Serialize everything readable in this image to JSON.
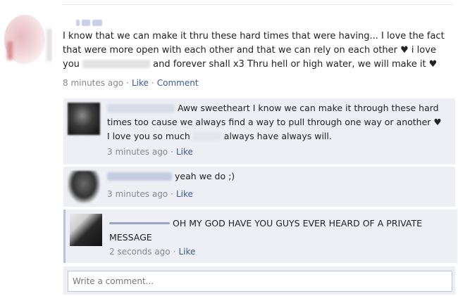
{
  "post": {
    "text_1": "I know that we can make it thru these hard times that were having... I love the fact that were more open with each other and that we can rely on each other ♥ i love you",
    "text_2": "and forever shall x3 Thru hell or high water, we will make it ♥",
    "time": "8 minutes ago",
    "like_label": "Like",
    "comment_label": "Comment"
  },
  "comments": [
    {
      "text_1": "Aww sweetheart I know we can make it through these hard times too cause we always find a way to pull through one way or another ♥ I love you so much",
      "text_2": "always have always will.",
      "time": "3 minutes ago",
      "like_label": "Like"
    },
    {
      "text_1": "yeah we do ;)",
      "time": "3 minutes ago",
      "like_label": "Like"
    },
    {
      "text_1": "OH MY GOD HAVE YOU GUYS EVER HEARD OF A PRIVATE MESSAGE",
      "time": "2 seconds ago",
      "like_label": "Like"
    }
  ],
  "composer": {
    "placeholder": "Write a comment..."
  },
  "separator": "·",
  "colors": {
    "link": "#3b5998",
    "comment_bg": "#edeff4",
    "meta_gray": "#8a8a8a"
  }
}
